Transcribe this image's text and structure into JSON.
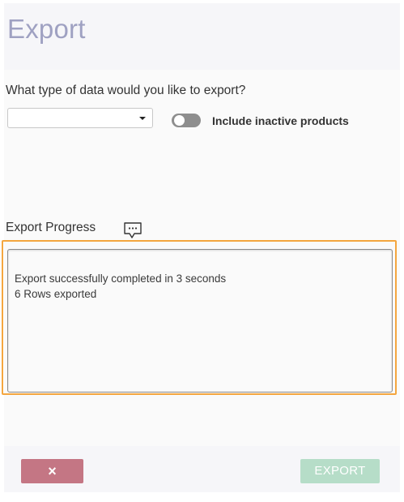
{
  "dialog": {
    "title": "Export"
  },
  "form": {
    "question": "What type of data would you like to export?",
    "data_type_select": {
      "value": ""
    },
    "include_inactive": {
      "label": "Include inactive products",
      "checked": false
    }
  },
  "progress": {
    "label": "Export Progress",
    "icon": "chat-icon",
    "log_lines": [
      "Export successfully completed in 3 seconds",
      "6 Rows exported"
    ]
  },
  "footer": {
    "cancel_label": "×",
    "export_label": "EXPORT"
  },
  "colors": {
    "title": "#9fa1c2",
    "cancel_button": "#c47684",
    "export_button_disabled": "#b6ddc8",
    "highlight_border": "#f4a63f",
    "toggle_off": "#8e8e8e"
  }
}
